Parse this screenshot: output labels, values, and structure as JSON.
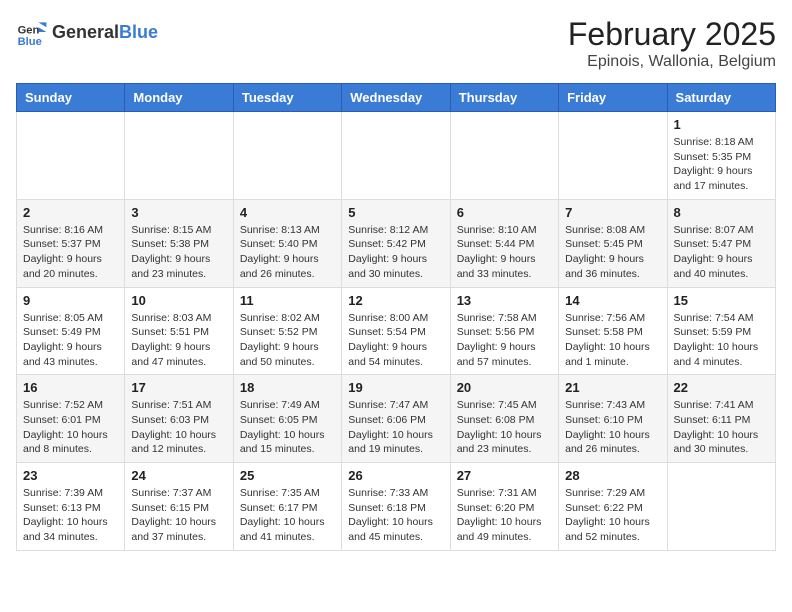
{
  "logo": {
    "text_general": "General",
    "text_blue": "Blue"
  },
  "title": "February 2025",
  "subtitle": "Epinois, Wallonia, Belgium",
  "days_of_week": [
    "Sunday",
    "Monday",
    "Tuesday",
    "Wednesday",
    "Thursday",
    "Friday",
    "Saturday"
  ],
  "weeks": [
    [
      {
        "day": "",
        "detail": ""
      },
      {
        "day": "",
        "detail": ""
      },
      {
        "day": "",
        "detail": ""
      },
      {
        "day": "",
        "detail": ""
      },
      {
        "day": "",
        "detail": ""
      },
      {
        "day": "",
        "detail": ""
      },
      {
        "day": "1",
        "detail": "Sunrise: 8:18 AM\nSunset: 5:35 PM\nDaylight: 9 hours and 17 minutes."
      }
    ],
    [
      {
        "day": "2",
        "detail": "Sunrise: 8:16 AM\nSunset: 5:37 PM\nDaylight: 9 hours and 20 minutes."
      },
      {
        "day": "3",
        "detail": "Sunrise: 8:15 AM\nSunset: 5:38 PM\nDaylight: 9 hours and 23 minutes."
      },
      {
        "day": "4",
        "detail": "Sunrise: 8:13 AM\nSunset: 5:40 PM\nDaylight: 9 hours and 26 minutes."
      },
      {
        "day": "5",
        "detail": "Sunrise: 8:12 AM\nSunset: 5:42 PM\nDaylight: 9 hours and 30 minutes."
      },
      {
        "day": "6",
        "detail": "Sunrise: 8:10 AM\nSunset: 5:44 PM\nDaylight: 9 hours and 33 minutes."
      },
      {
        "day": "7",
        "detail": "Sunrise: 8:08 AM\nSunset: 5:45 PM\nDaylight: 9 hours and 36 minutes."
      },
      {
        "day": "8",
        "detail": "Sunrise: 8:07 AM\nSunset: 5:47 PM\nDaylight: 9 hours and 40 minutes."
      }
    ],
    [
      {
        "day": "9",
        "detail": "Sunrise: 8:05 AM\nSunset: 5:49 PM\nDaylight: 9 hours and 43 minutes."
      },
      {
        "day": "10",
        "detail": "Sunrise: 8:03 AM\nSunset: 5:51 PM\nDaylight: 9 hours and 47 minutes."
      },
      {
        "day": "11",
        "detail": "Sunrise: 8:02 AM\nSunset: 5:52 PM\nDaylight: 9 hours and 50 minutes."
      },
      {
        "day": "12",
        "detail": "Sunrise: 8:00 AM\nSunset: 5:54 PM\nDaylight: 9 hours and 54 minutes."
      },
      {
        "day": "13",
        "detail": "Sunrise: 7:58 AM\nSunset: 5:56 PM\nDaylight: 9 hours and 57 minutes."
      },
      {
        "day": "14",
        "detail": "Sunrise: 7:56 AM\nSunset: 5:58 PM\nDaylight: 10 hours and 1 minute."
      },
      {
        "day": "15",
        "detail": "Sunrise: 7:54 AM\nSunset: 5:59 PM\nDaylight: 10 hours and 4 minutes."
      }
    ],
    [
      {
        "day": "16",
        "detail": "Sunrise: 7:52 AM\nSunset: 6:01 PM\nDaylight: 10 hours and 8 minutes."
      },
      {
        "day": "17",
        "detail": "Sunrise: 7:51 AM\nSunset: 6:03 PM\nDaylight: 10 hours and 12 minutes."
      },
      {
        "day": "18",
        "detail": "Sunrise: 7:49 AM\nSunset: 6:05 PM\nDaylight: 10 hours and 15 minutes."
      },
      {
        "day": "19",
        "detail": "Sunrise: 7:47 AM\nSunset: 6:06 PM\nDaylight: 10 hours and 19 minutes."
      },
      {
        "day": "20",
        "detail": "Sunrise: 7:45 AM\nSunset: 6:08 PM\nDaylight: 10 hours and 23 minutes."
      },
      {
        "day": "21",
        "detail": "Sunrise: 7:43 AM\nSunset: 6:10 PM\nDaylight: 10 hours and 26 minutes."
      },
      {
        "day": "22",
        "detail": "Sunrise: 7:41 AM\nSunset: 6:11 PM\nDaylight: 10 hours and 30 minutes."
      }
    ],
    [
      {
        "day": "23",
        "detail": "Sunrise: 7:39 AM\nSunset: 6:13 PM\nDaylight: 10 hours and 34 minutes."
      },
      {
        "day": "24",
        "detail": "Sunrise: 7:37 AM\nSunset: 6:15 PM\nDaylight: 10 hours and 37 minutes."
      },
      {
        "day": "25",
        "detail": "Sunrise: 7:35 AM\nSunset: 6:17 PM\nDaylight: 10 hours and 41 minutes."
      },
      {
        "day": "26",
        "detail": "Sunrise: 7:33 AM\nSunset: 6:18 PM\nDaylight: 10 hours and 45 minutes."
      },
      {
        "day": "27",
        "detail": "Sunrise: 7:31 AM\nSunset: 6:20 PM\nDaylight: 10 hours and 49 minutes."
      },
      {
        "day": "28",
        "detail": "Sunrise: 7:29 AM\nSunset: 6:22 PM\nDaylight: 10 hours and 52 minutes."
      },
      {
        "day": "",
        "detail": ""
      }
    ]
  ]
}
